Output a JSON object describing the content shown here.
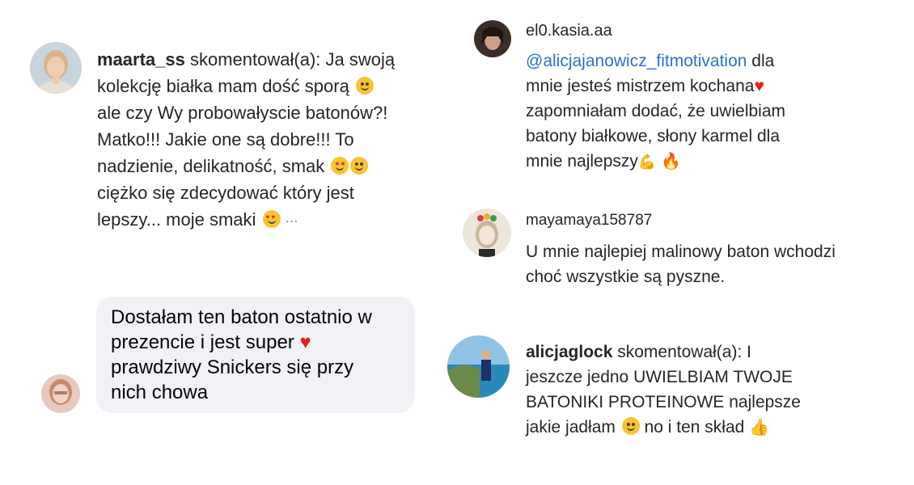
{
  "comments": [
    {
      "username": "maarta_ss",
      "verb": "skomentował(a):",
      "lines": [
        "Ja swoją",
        "kolekcję białka mam dość sporą",
        "ale czy Wy probowałyscie batonów?!",
        "Matko!!! Jakie one są dobre!!! To",
        "nadzienie, delikatność, smak",
        "ciężko się zdecydować który jest",
        "lepszy... moje smaki"
      ]
    },
    {
      "lines": [
        "Dostałam ten baton ostatnio w",
        "prezencie i jest super",
        "prawdziwy Snickers się przy",
        "nich chowa"
      ]
    },
    {
      "username": "el0.kasia.aa",
      "mention": "@alicjajanowicz_fitmotivation",
      "lines": [
        "dla",
        "mnie jesteś mistrzem kochana",
        "zapomniałam dodać, że uwielbiam",
        "batony białkowe, słony karmel dla",
        "mnie najlepszy"
      ]
    },
    {
      "username": "mayamaya158787",
      "lines": [
        "U mnie najlepiej malinowy baton wchodzi",
        "choć wszystkie są pyszne."
      ]
    },
    {
      "username": "alicjaglock",
      "verb": "skomentował(a):",
      "lines": [
        "I",
        "jeszcze jedno UWIELBIAM TWOJE",
        "BATONIKI PROTEINOWE najlepsze",
        "jakie jadłam",
        "no i ten skład"
      ]
    }
  ],
  "icons": {
    "heart": "♥",
    "fire": "🔥",
    "flex": "💪",
    "thumb": "👍"
  }
}
